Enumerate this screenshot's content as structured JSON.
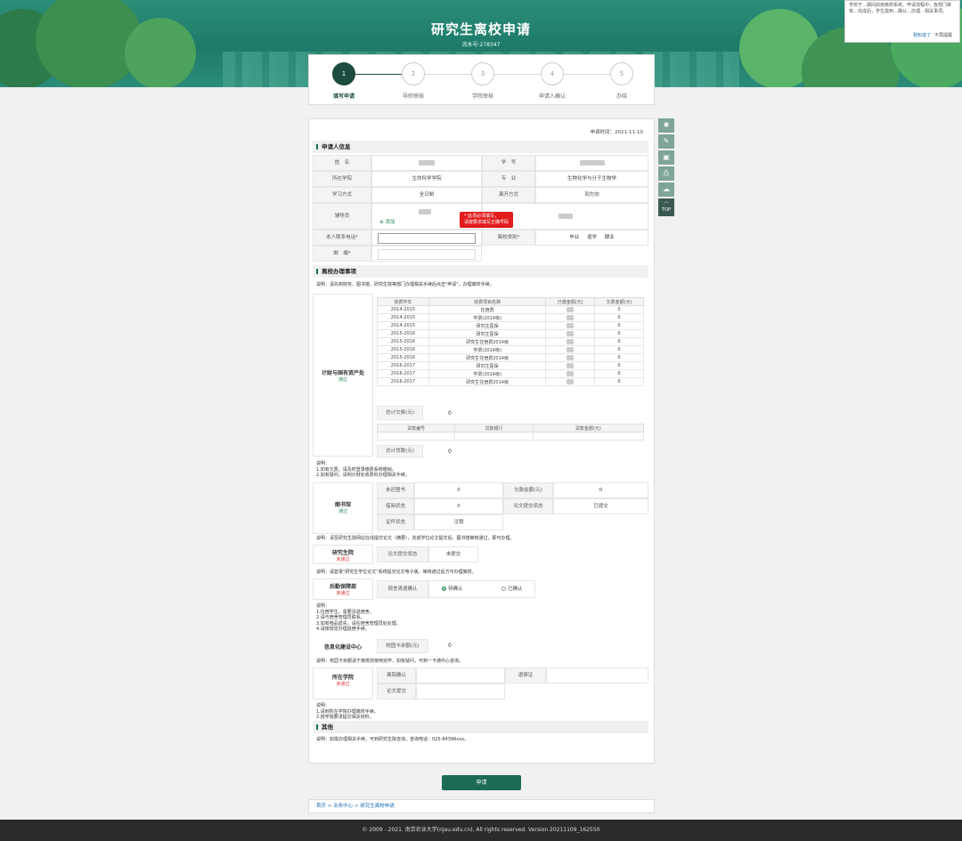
{
  "banner": {
    "title": "研究生离校申请",
    "serial": "流水号:278347"
  },
  "notice": {
    "text": "学校于…期间启用离校系统。申请流程中，各部门审核…完成后，学生需到…确认…办理…相关事项。",
    "remind_later": "我知道了",
    "no_remind": "不再提醒"
  },
  "steps": [
    {
      "num": "1",
      "label": "填写申请",
      "active": true
    },
    {
      "num": "2",
      "label": "导师审核",
      "active": false
    },
    {
      "num": "3",
      "label": "学院审核",
      "active": false
    },
    {
      "num": "4",
      "label": "申请人确认",
      "active": false
    },
    {
      "num": "5",
      "label": "办结",
      "active": false
    }
  ],
  "apply_time": "申请时间：2021-11-10",
  "applicant": {
    "section": "申请人信息",
    "name_label": "姓　名",
    "id_label": "学　号",
    "college_label": "所在学院",
    "college": "生命科学学院",
    "major_label": "专　业",
    "major": "生物化学与分子生物学",
    "study_label": "学习方式",
    "study": "全日制",
    "leave_label": "离开方式",
    "leave": "到方向",
    "tutor_label": "辅导员",
    "add_label": "添加",
    "phone_label": "本人联系电话*",
    "phone_tip": "* 此项必须填写，\n请按要求填写正确号码",
    "reason_label": "离校类别*",
    "reason_opts": [
      "毕业",
      "退学",
      "肄业"
    ],
    "addr_label": "邮　编*"
  },
  "matters": {
    "section": "离校办理事项",
    "note": "说明：请先到财务、图书馆、研究生院等部门办理相关手续后点击\"申请\"，办理离校手续。"
  },
  "finance": {
    "dept": "计财与国有资产处",
    "status": "通过",
    "cols": [
      "收费学年",
      "收费项目名称",
      "已缴金额(元)",
      "欠费金额(元)"
    ],
    "rows": [
      [
        "2014-2015",
        "住宿费",
        "0"
      ],
      [
        "2014-2015",
        "学费(2014级)",
        "0"
      ],
      [
        "2014-2015",
        "研究生医保",
        "0"
      ],
      [
        "2015-2016",
        "研究生医保",
        "0"
      ],
      [
        "2015-2016",
        "研究生住宿费2014级",
        "0"
      ],
      [
        "2015-2016",
        "学费(2014级)",
        "0"
      ],
      [
        "2015-2016",
        "研究生住宿费2014级",
        "0"
      ],
      [
        "2016-2017",
        "研究生医保",
        "0"
      ],
      [
        "2016-2017",
        "学费(2014级)",
        "0"
      ],
      [
        "2016-2017",
        "研究生住宿费2014级",
        "0"
      ]
    ],
    "total_label": "总计欠费(元)",
    "total": "0",
    "loan_cols": [
      "贷款编号",
      "贷款银行",
      "贷款金额(元)"
    ],
    "loan_total_label": "总计贷款(元)",
    "loan_total": "0",
    "note": "说明：\n1.如有欠费，请及时登录缴费系统缴纳。\n2.如有疑问，请到计财处收费科办理相关手续。"
  },
  "library": {
    "dept": "图书馆",
    "status": "通过",
    "borrow_label": "未还图书",
    "borrow": "0",
    "fine_label": "欠款金额(元)",
    "fine": "0",
    "overdue_label": "借阅状态",
    "overdue": "0",
    "thesis_label": "论文提交状态",
    "thesis": "已提交",
    "card_label": "证件状态",
    "card": "注销",
    "note": "说明：请至研究生院网站在线提交论文（摘要），完成学位论文提交后，图书馆审核通过，即可办理。"
  },
  "grad": {
    "dept": "研究生院",
    "status": "未通过",
    "label": "论文提交状态",
    "value": "未提交",
    "note": "说明：请登录\"研究生学位论文\"系统提交论文电子版，审核通过后方可办理离校。"
  },
  "logistics": {
    "dept": "后勤保障部",
    "status": "未通过",
    "label": "宿舍清退确认",
    "opt1": "待确认",
    "opt2": "已确认",
    "note": "说明：\n1.住宿学生，需要清退宿舍。\n2.请与宿舍管理员联系。\n3.如有物品遗失，请在宿舍管理员处处理。\n4.请按规定办理退宿手续。"
  },
  "info": {
    "dept": "信息化建设中心",
    "label": "校园卡余额(元)",
    "value": "0",
    "note": "说明：校园卡余额请于离校前使用完毕，如有疑问，可到一卡通中心咨询。"
  },
  "college": {
    "dept": "所在学院",
    "status": "未通过",
    "label1": "离院确认",
    "label2": "论文提交",
    "right_label": "退宿证",
    "note": "说明：\n1.请到所在学院办理离校手续。\n2.按学院要求提交相关材料。"
  },
  "other": {
    "section": "其他",
    "note": "说明：如需办理相关手续，可到研究生院咨询，咨询电话：025-84396xxx。"
  },
  "submit": "申请",
  "crumb": "首页 > 业务中心 > 研究生离校申请",
  "footer": "© 2009 - 2021. 南京农业大学(njau.edu.cn), All rights reserved. Version 20211109_162550"
}
